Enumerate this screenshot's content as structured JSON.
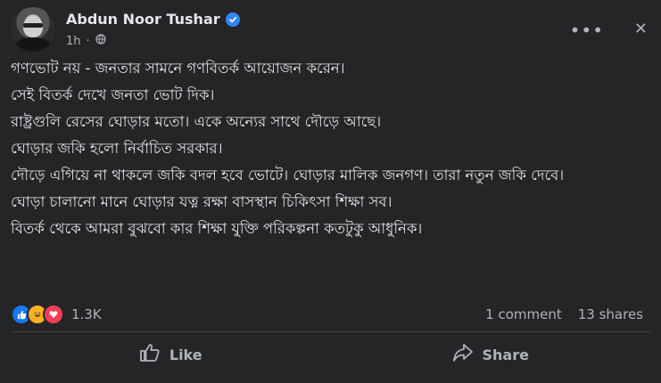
{
  "post": {
    "author": "Abdun Noor Tushar",
    "time": "1h",
    "menu_glyph": "•••",
    "close_glyph": "✕",
    "paragraphs": [
      "গণভোট নয় - জনতার সামনে গণবিতর্ক আয়োজন করেন।",
      "সেই বিতর্ক দেখে জনতা ভোট দিক।",
      "রাষ্ট্রগুলি রেসের ঘোড়ার মতো। একে অন্যের সাথে দৌড়ে আছে।",
      "ঘোড়ার জকি হলো নির্বাচিত সরকার।",
      "দৌড়ে এগিয়ে না থাকলে জকি বদল হবে ভোটে। ঘোড়ার মালিক জনগণ। তারা নতুন জকি দেবে।",
      "ঘোড়া চালানো মানে ঘোড়ার যত্ন রক্ষা বাসস্থান চিকিৎসা শিক্ষা সব।",
      "বিতর্ক থেকে আমরা বুঝবো কার শিক্ষা যুক্তি পরিকল্পনা কতটুকু আধুনিক।"
    ]
  },
  "stats": {
    "reaction_count": "1.3K",
    "comments": "1 comment",
    "shares": "13 shares"
  },
  "actions": {
    "like": "Like",
    "share": "Share"
  },
  "colors": {
    "background": "#242526",
    "text": "#e4e6eb",
    "muted": "#b0b3b8",
    "verified": "#2d88ff"
  }
}
